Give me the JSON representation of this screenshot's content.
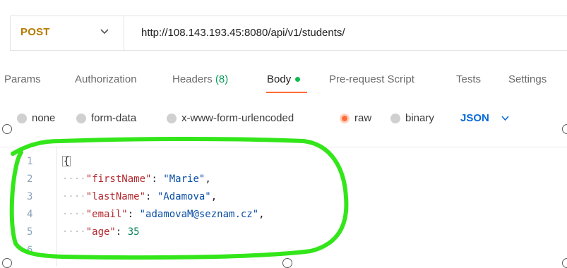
{
  "request": {
    "method": "POST",
    "url": "http://108.143.193.45:8080/api/v1/students/"
  },
  "tabs": [
    {
      "label": "Params"
    },
    {
      "label": "Authorization"
    },
    {
      "label": "Headers",
      "count": "(8)"
    },
    {
      "label": "Body",
      "active": true
    },
    {
      "label": "Pre-request Script"
    },
    {
      "label": "Tests"
    },
    {
      "label": "Settings"
    }
  ],
  "body_types": [
    {
      "label": "none"
    },
    {
      "label": "form-data"
    },
    {
      "label": "x-www-form-urlencoded"
    },
    {
      "label": "raw",
      "selected": true
    },
    {
      "label": "binary"
    }
  ],
  "format": {
    "selected": "JSON"
  },
  "editor": {
    "line_numbers": [
      "1",
      "2",
      "3",
      "4",
      "5",
      "6"
    ],
    "open_brace": "{",
    "fields": [
      {
        "key": "\"firstName\"",
        "value": "\"Marie\"",
        "type": "string"
      },
      {
        "key": "\"lastName\"",
        "value": "\"Adamova\"",
        "type": "string"
      },
      {
        "key": "\"email\"",
        "value": "\"adamovaM@seznam.cz\"",
        "type": "string"
      },
      {
        "key": "\"age\"",
        "value": "35",
        "type": "number"
      }
    ]
  },
  "colors": {
    "accent": "#ff6c37",
    "annotation": "#33e61a",
    "json_select": "#0a6bd8",
    "active_dot": "#0cbb52"
  }
}
